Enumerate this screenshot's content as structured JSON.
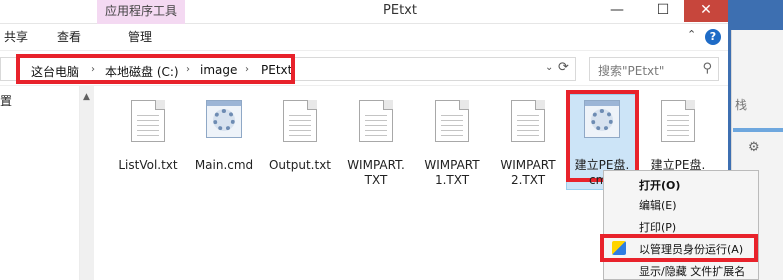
{
  "window": {
    "title": "PEtxt",
    "contextual_tab": "应用程序工具",
    "min_glyph": "—",
    "max_glyph": "☐",
    "close_glyph": "✕"
  },
  "ribbon": {
    "tabs": [
      "共享",
      "查看",
      "管理"
    ],
    "help_glyph": "?",
    "collapse_glyph": "⌃"
  },
  "address": {
    "breadcrumbs": [
      "这台电脑",
      "本地磁盘 (C:)",
      "image",
      "PEtxt"
    ],
    "separator": "›",
    "dropdown_glyph": "⌄",
    "refresh_glyph": "⟳"
  },
  "search": {
    "placeholder": "搜索\"PEtxt\"",
    "icon": "search-icon"
  },
  "nav": {
    "item": "置"
  },
  "files": [
    {
      "name": "ListVol.txt",
      "type": "txt",
      "icon": "text-file-icon"
    },
    {
      "name": "Main.cmd",
      "type": "cmd",
      "icon": "cmd-file-icon"
    },
    {
      "name": "Output.txt",
      "type": "txt",
      "icon": "text-file-icon"
    },
    {
      "name": "WIMPART.\nTXT",
      "type": "txt",
      "icon": "text-file-icon"
    },
    {
      "name": "WIMPART\n1.TXT",
      "type": "txt",
      "icon": "text-file-icon"
    },
    {
      "name": "WIMPART\n2.TXT",
      "type": "txt",
      "icon": "text-file-icon"
    },
    {
      "name": "建立PE盘.\ncmd",
      "type": "cmd",
      "icon": "cmd-file-icon",
      "selected": true
    },
    {
      "name": "建立PE盘.\ntxt",
      "type": "txt",
      "icon": "text-file-icon"
    }
  ],
  "context_menu": {
    "items": [
      "打开(O)",
      "编辑(E)",
      "打印(P)",
      "以管理员身份运行(A)",
      "显示/隐藏 文件扩展名"
    ],
    "highlighted": "以管理员身份运行(A)"
  },
  "right_window": {
    "text": "栈"
  },
  "colors": {
    "accent_red": "#e8222b",
    "selection": "#cce4f7",
    "contextual_tab": "#f4d9f2",
    "close_button": "#c7463c"
  }
}
